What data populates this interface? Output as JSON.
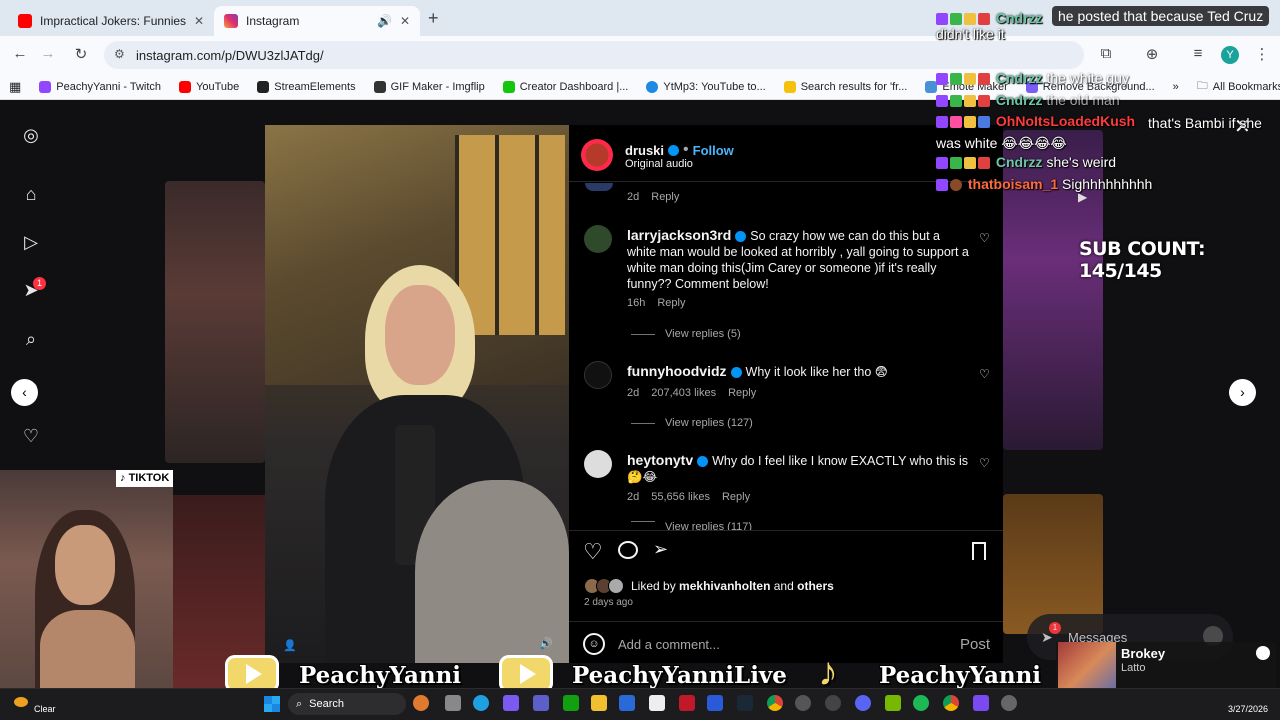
{
  "browser": {
    "tabs": [
      {
        "title": "Impractical Jokers: Funniest Fa",
        "active": false
      },
      {
        "title": "Instagram",
        "active": true
      }
    ],
    "new_tab": "+",
    "url": "instagram.com/p/DWU3zlJATdg/",
    "bookmarks": [
      "PeachyYanni - Twitch",
      "YouTube",
      "StreamElements",
      "GIF Maker - Imgflip",
      "Creator Dashboard |...",
      "YtMp3: YouTube to...",
      "Search results for 'fr...",
      "Emote Maker",
      "Remove Background..."
    ],
    "bookmarks_more": "»",
    "all_bookmarks": "All Bookmarks",
    "profile_initial": "Y",
    "colors": {
      "accent": "#0095f6",
      "chrome": "#dfe7f1"
    }
  },
  "instagram": {
    "notification_count": "1",
    "post_author": "druski",
    "follow_label": "Follow",
    "audio_label": "Original audio",
    "first_meta": {
      "time": "2d",
      "reply": "Reply"
    },
    "comments": [
      {
        "user": "larryjackson3rd",
        "text": "So crazy how we can do this but a white man would be looked at horribly , yall going to support a white man doing this(Jim Carey or someone )if it's really funny?? Comment below!",
        "time": "16h",
        "likes": "",
        "reply": "Reply",
        "view_replies": "View replies (5)"
      },
      {
        "user": "funnyhoodvidz",
        "text": "Why it look like her tho 😨",
        "time": "2d",
        "likes": "207,403 likes",
        "reply": "Reply",
        "view_replies": "View replies (127)"
      },
      {
        "user": "heytonytv",
        "text": "Why do I feel like I know EXACTLY who this is 🤔😂",
        "time": "2d",
        "likes": "55,656 likes",
        "reply": "Reply",
        "view_replies": "View replies (117)"
      }
    ],
    "liked_by_prefix": "Liked by",
    "liked_by_user": "mekhivanholten",
    "liked_by_and": "and",
    "liked_by_others": "others",
    "post_age": "2 days ago",
    "add_comment_placeholder": "Add a comment...",
    "post_button": "Post",
    "messages_label": "Messages",
    "messages_badge": "1"
  },
  "stream_overlay": {
    "chat": [
      {
        "name": "Cndrzz",
        "text": "didn't like it",
        "name_color": "#6cc6a5",
        "top_clip": true
      },
      {
        "name": "Cndrzz",
        "text": "the white guy",
        "name_color": "#6cc6a5"
      },
      {
        "name": "Cndrzz",
        "text": "the old man",
        "name_color": "#6cc6a5"
      },
      {
        "name": "OhNoItsLoadedKush",
        "text": "that's Bambi if she was white 😂😂😂😂",
        "name_color": "#ff3b3b"
      },
      {
        "name": "Cndrzz",
        "text": "she's weird",
        "name_color": "#6cc6a5"
      },
      {
        "name": "thatboisam_1",
        "text": "Sighhhhhhhhh",
        "name_color": "#ff6a3d"
      }
    ],
    "alert_text": "he posted that because Ted Cruz",
    "sub_count": "SUB COUNT: 145/145",
    "tiktok_label": "TIKTOK",
    "banner_names": [
      "PeachyYanni",
      "PeachyYanniLive",
      "PeachyYanni"
    ],
    "now_playing": {
      "title": "Brokey",
      "artist": "Latto"
    }
  },
  "taskbar": {
    "weather": "Clear",
    "search_label": "Search",
    "date": "3/27/2026"
  }
}
